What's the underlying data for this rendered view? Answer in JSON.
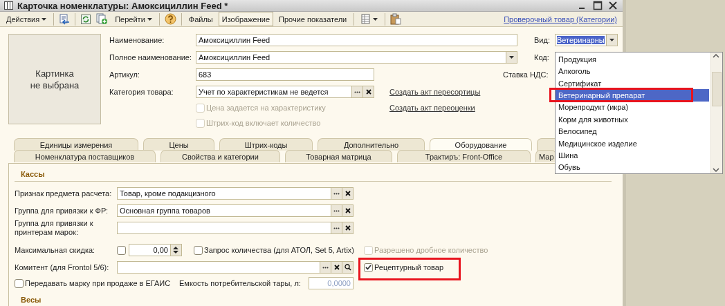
{
  "window": {
    "title": "Карточка номенклатуры: Амоксициллин Feed *"
  },
  "toolbar": {
    "items": [
      {
        "kind": "menu",
        "label": "Действия"
      },
      {
        "kind": "separator"
      },
      {
        "kind": "icon"
      },
      {
        "kind": "separator"
      },
      {
        "kind": "icon"
      },
      {
        "kind": "icon"
      },
      {
        "kind": "menu",
        "label": "Перейти"
      },
      {
        "kind": "separator"
      },
      {
        "kind": "icon"
      },
      {
        "kind": "separator"
      },
      {
        "kind": "button",
        "label": "Файлы",
        "pressed": false
      },
      {
        "kind": "button",
        "label": "Изображение",
        "pressed": true
      },
      {
        "kind": "button",
        "label": "Прочие показатели",
        "pressed": false
      },
      {
        "kind": "separator"
      },
      {
        "kind": "icon_menu"
      },
      {
        "kind": "separator"
      },
      {
        "kind": "icon"
      }
    ],
    "link": "Проверочный товар (Категории)"
  },
  "picture_placeholder": "Картинка не выбрана",
  "fields": {
    "name": {
      "label": "Наименование:",
      "value": "Амоксициллин Feed"
    },
    "full_name": {
      "label": "Полное наименование:",
      "value": "Амоксициллин Feed"
    },
    "article": {
      "label": "Артикул:",
      "value": "683"
    },
    "category": {
      "label": "Категория товара:",
      "value": "Учет по характеристикам не ведется"
    },
    "price_per_characteristic": {
      "label": "Цена задается на характеристику",
      "checked": false,
      "disabled": true
    },
    "barcode_includes_quantity": {
      "label": "Штрих-код включает количество",
      "checked": false,
      "disabled": true
    },
    "kind": {
      "label": "Вид:",
      "value": "Ветеринарны"
    },
    "code": {
      "label": "Код:"
    },
    "vat": {
      "label": "Ставка НДС:"
    }
  },
  "links": [
    "Создать акт пересортицы",
    "Создать акт переоценки"
  ],
  "tabs": [
    [
      {
        "label": "Единицы измерения",
        "selected": false
      },
      {
        "label": "Цены",
        "selected": false
      },
      {
        "label": "Штрих-коды",
        "selected": false
      },
      {
        "label": "Дополнительно",
        "selected": false
      },
      {
        "label": "Оборудование",
        "selected": true
      },
      {
        "selected": false
      }
    ],
    [
      {
        "label": "Номенклатура поставщиков",
        "selected": false
      },
      {
        "label": "Свойства и категории",
        "selected": false
      },
      {
        "label": "Товарная матрица",
        "selected": false
      },
      {
        "label": "Трактиръ: Front-Office",
        "selected": false
      },
      {
        "label": "Мар",
        "selected": false
      }
    ]
  ],
  "equipment": {
    "cash_section": "Кассы",
    "payment_subject": {
      "label": "Признак предмета расчета:",
      "value": "Товар, кроме подакцизного"
    },
    "fr_group": {
      "label": "Группа для привязки к ФР:",
      "value": "Основная группа товаров"
    },
    "printer_group": {
      "label": "Группа для привязки к принтерам марок:"
    },
    "max_discount": {
      "label": "Максимальная скидка:",
      "checked": false,
      "value": "0,00"
    },
    "request_quantity": {
      "label": "Запрос количества (для АТОЛ, Set 5, Artix)",
      "checked": false
    },
    "fractional_quantity": {
      "label": "Разрешено дробное количество",
      "checked": false,
      "disabled": true
    },
    "consignor": {
      "label": "Комитент (для Frontol 5/6):"
    },
    "prescription": {
      "label": "Рецептурный товар",
      "checked": true
    },
    "egais_mark": {
      "label": "Передавать марку при продаже в ЕГАИС",
      "checked": false
    },
    "container_volume": {
      "label": "Емкость потребительской тары, л:",
      "value": "0,0000"
    },
    "scales_section": "Весы"
  },
  "dropdown": {
    "items": [
      {
        "label": "Продукция",
        "selected": false
      },
      {
        "label": "Алкоголь",
        "selected": false
      },
      {
        "label": "Сертификат",
        "selected": false
      },
      {
        "label": "Ветеринарный препарат",
        "selected": true
      },
      {
        "label": "Морепродукт (икра)",
        "selected": false
      },
      {
        "label": "Корм для животных",
        "selected": false
      },
      {
        "label": "Велосипед",
        "selected": false
      },
      {
        "label": "Медицинское изделие",
        "selected": false
      },
      {
        "label": "Шина",
        "selected": false
      },
      {
        "label": "Обувь",
        "selected": false
      }
    ]
  }
}
